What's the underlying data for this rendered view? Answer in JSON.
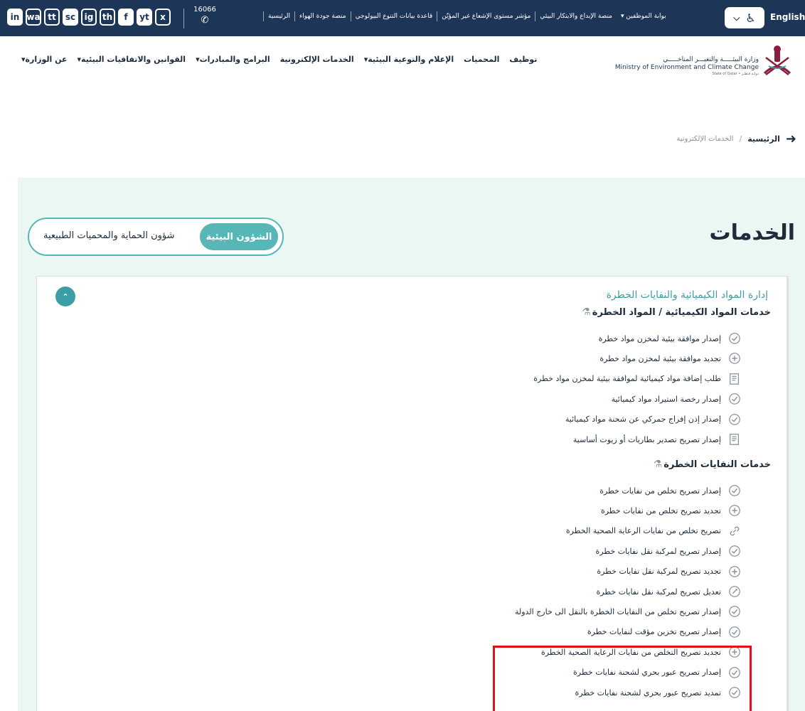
{
  "topbar": {
    "social": [
      "in",
      "wa",
      "tt",
      "sc",
      "ig",
      "th",
      "f",
      "yt",
      "x"
    ],
    "hotline": "16066",
    "links": [
      "الرئيسية",
      "منصة جودة الهواء",
      "قاعدة بيانات التنوع البيولوجي",
      "مؤشر مستوى الإشعاع غير المؤيّن",
      "منصة الإبداع والابتكار البيئي",
      "بوابة الموظفين ▾"
    ],
    "lang": "English"
  },
  "logo": {
    "arabic": "وزارة البيئـــــة والتغيـــر المناخـــــي",
    "english": "Ministry of Environment and Climate Change",
    "state": "State of Qatar • دولـة قـطـر"
  },
  "nav": {
    "items": [
      "عن الوزارة▾",
      "القوانين والاتفاقيات البيئية▾",
      "البرامج والمبادرات▾",
      "الخدمات الإلكترونية",
      "الإعلام والتوعية البيئية▾",
      "المحميات",
      "توظيف"
    ]
  },
  "breadcrumb": {
    "home": "الرئيسية",
    "sep": "/",
    "current": "الخدمات الإلكترونية"
  },
  "page": {
    "title": "الخدمات"
  },
  "toggle": {
    "active": "الشؤون البيئية",
    "inactive": "شؤون الحماية والمحميات الطبيعية"
  },
  "category": "إدارة المواد الكيميائية والنفايات الخطرة",
  "sections": [
    {
      "title": "خدمات المواد الكيميائية / المواد الخطرة",
      "items": [
        {
          "label": "إصدار موافقة بيئية لمخزن مواد خطرة",
          "icon": "check-circle-icon"
        },
        {
          "label": "تجديد موافقة بيئية لمخزن مواد خطرة",
          "icon": "plus-circle-icon"
        },
        {
          "label": "طلب إضافة مواد كيميائية لموافقة بيئية لمخزن مواد خطرة",
          "icon": "document-list-icon"
        },
        {
          "label": "إصدار رخصة استيراد مواد كيميائية",
          "icon": "check-circle-icon"
        },
        {
          "label": "إصدار إذن إفراج جمركي عن شحنة مواد كيميائية",
          "icon": "check-circle-icon"
        },
        {
          "label": "إصدار تصريح تصدير بطاريات أو زيوت أساسية",
          "icon": "document-list-icon"
        }
      ]
    },
    {
      "title": "خدمات النفايات الخطرة",
      "items": [
        {
          "label": "إصدار تصريح تخلص من نفايات خطرة",
          "icon": "check-circle-icon"
        },
        {
          "label": "تجديد تصريح تخلص من نفايات خطرة",
          "icon": "plus-circle-icon"
        },
        {
          "label": "تصريح تخلص من نفايات الرعاية الصحية الخطرة",
          "icon": "link-icon"
        },
        {
          "label": "إصدار تصريح لمركبة نقل نفايات خطرة",
          "icon": "check-circle-icon"
        },
        {
          "label": "تجديد تصريح لمركبة نقل نفايات خطرة",
          "icon": "plus-circle-icon"
        },
        {
          "label": "تعديل تصريح لمركبة نقل نفايات خطرة",
          "icon": "edit-circle-icon"
        },
        {
          "label": "إصدار تصريح تخلص من النفايات الخطرة بالنقل الى خارج الدولة",
          "icon": "check-circle-icon"
        },
        {
          "label": "إصدار تصريح تخزين مؤقت لنفايات خطرة",
          "icon": "check-circle-icon"
        },
        {
          "label": "تجديد تصريح التخلص من نفايات الرعاية الصحية الخطرة",
          "icon": "plus-circle-icon"
        },
        {
          "label": "إصدار تصريح عبور بحري لشحنة نفايات خطرة",
          "icon": "check-circle-icon"
        },
        {
          "label": "تمديد تصريح عبور بحري لشحنة نفايات خطرة",
          "icon": "check-circle-icon"
        }
      ]
    }
  ],
  "colors": {
    "topbar": "#1d3557",
    "accent": "#3d9da6",
    "panel_bg": "#eaf7f3",
    "highlight": "#e0101a"
  }
}
